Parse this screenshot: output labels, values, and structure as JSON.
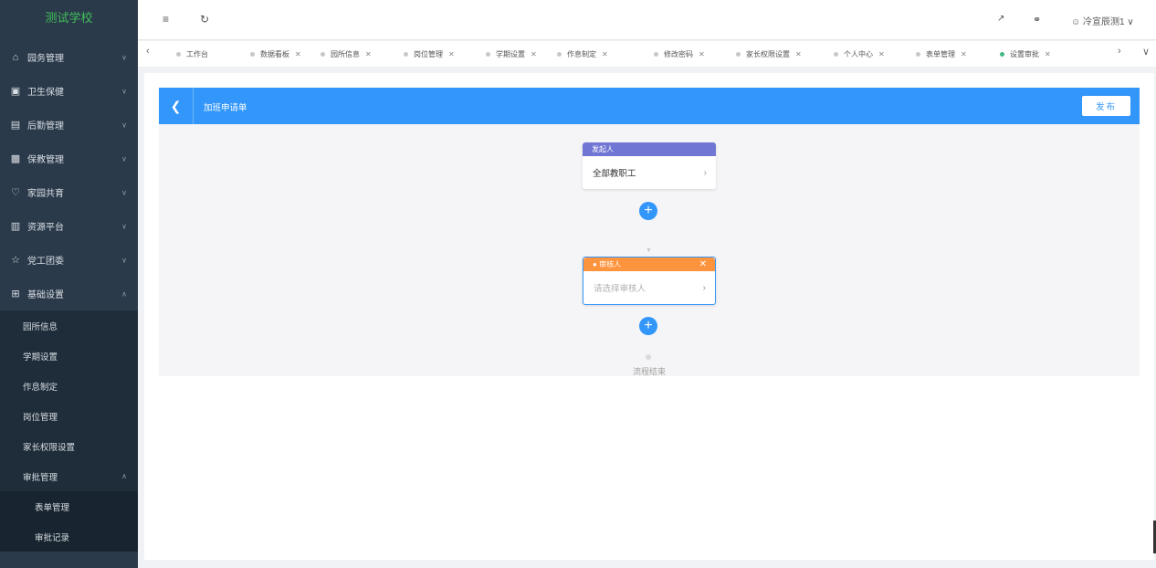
{
  "app": {
    "school_name": "测试学校"
  },
  "sidebar": {
    "items": [
      {
        "label": "园务管理",
        "icon": "bank-icon"
      },
      {
        "label": "卫生保健",
        "icon": "clinic-icon"
      },
      {
        "label": "后勤管理",
        "icon": "calendar-icon"
      },
      {
        "label": "保教管理",
        "icon": "briefcase-icon"
      },
      {
        "label": "家园共育",
        "icon": "heart-icon"
      },
      {
        "label": "资源平台",
        "icon": "printer-icon"
      },
      {
        "label": "党工团委",
        "icon": "star-icon"
      },
      {
        "label": "基础设置",
        "icon": "grid-icon"
      }
    ],
    "sub_items": [
      "园所信息",
      "学期设置",
      "作息制定",
      "岗位管理",
      "家长权限设置",
      "审批管理"
    ],
    "sub_sub_items": [
      "表单管理",
      "审批记录"
    ]
  },
  "header": {
    "user_name": "冷宣辰测1"
  },
  "tabs": [
    {
      "label": "工作台",
      "closable": false
    },
    {
      "label": "数据看板",
      "closable": true
    },
    {
      "label": "园所信息",
      "closable": true
    },
    {
      "label": "岗位管理",
      "closable": true
    },
    {
      "label": "学期设置",
      "closable": true
    },
    {
      "label": "作息制定",
      "closable": true
    },
    {
      "label": "修改密码",
      "closable": true
    },
    {
      "label": "家长权限设置",
      "closable": true
    },
    {
      "label": "个人中心",
      "closable": true
    },
    {
      "label": "表单管理",
      "closable": true
    },
    {
      "label": "设置审批",
      "closable": true,
      "active": true
    }
  ],
  "designer": {
    "title": "加班申请单",
    "publish_label": "发布",
    "initiator": {
      "header": "发起人",
      "value": "全部教职工",
      "color": "#6f76d4"
    },
    "approver": {
      "header": "审核人",
      "placeholder": "请选择审核人",
      "color": "#ff943e"
    },
    "end_label": "流程结束",
    "accent": "#3296fa"
  }
}
